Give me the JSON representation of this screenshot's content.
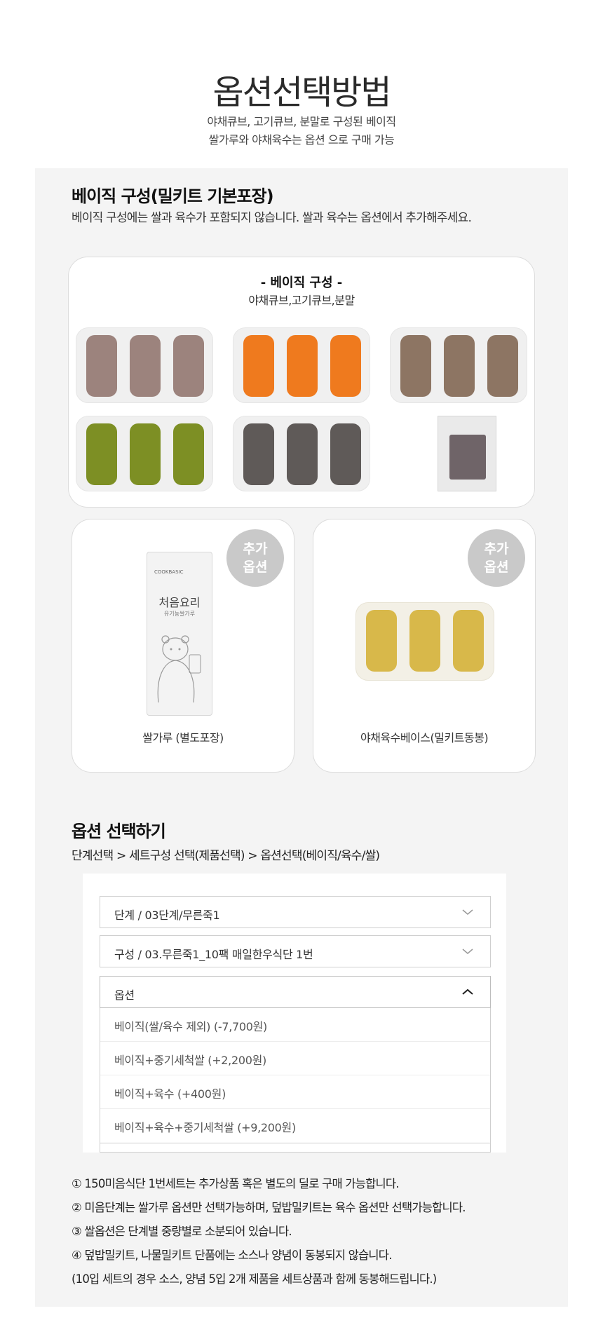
{
  "header": {
    "title": "옵션선택방법",
    "subtitle_line1": "야채큐브, 고기큐브, 분말로 구성된 베이직",
    "subtitle_line2": "쌀가루와 야채육수는 옵션 으로 구매 가능"
  },
  "basic_section": {
    "title": "베이직 구성(밀키트 기본포장)",
    "description": "베이직 구성에는 쌀과 육수가 포함되지 않습니다. 쌀과 육수는 옵션에서 추가해주세요.",
    "card_heading": "- 베이직 구성 -",
    "card_subheading": "야채큐브,고기큐브,분말",
    "cube_colors": [
      "#9c837d",
      "#ef7a1e",
      "#8d7563",
      "#7d8f24",
      "#5f5a58"
    ]
  },
  "option_cards": [
    {
      "badge_line1": "추가",
      "badge_line2": "옵션",
      "pouch_brand": "COOKBASIC",
      "pouch_name": "처음요리",
      "pouch_small": "유기농쌀가루",
      "caption": "쌀가루 (별도포장)"
    },
    {
      "badge_line1": "추가",
      "badge_line2": "옵션",
      "caption": "야채육수베이스(밀키트동봉)",
      "cube_color": "#d8b84a"
    }
  ],
  "option_select": {
    "title": "옵션 선택하기",
    "steps": "단계선택 > 세트구성 선택(제품선택) > 옵션선택(베이직/육수/쌀)",
    "step_select": "단계 / 03단계/무른죽1",
    "set_select": "구성 / 03.무른죽1_10팩 매일한우식단 1번",
    "option_select": "옵션",
    "dropdown_items": [
      "베이직(쌀/육수 제외) (-7,700원)",
      "베이직+중기세척쌀 (+2,200원)",
      "베이직+육수 (+400원)",
      "베이직+육수+중기세척쌀 (+9,200원)"
    ]
  },
  "notes": [
    "① 150미음식단 1번세트는 추가상품 혹은 별도의 딜로 구매 가능합니다.",
    "② 미음단계는 쌀가루 옵션만 선택가능하며, 덮밥밀키트는 육수 옵션만 선택가능합니다.",
    "③ 쌀옵션은 단계별 중량별로 소분되어 있습니다.",
    "④ 덮밥밀키트, 나물밀키트 단품에는 소스나 양념이 동봉되지 않습니다.",
    "(10입 세트의 경우 소스, 양념 5입 2개 제품을 세트상품과 함께 동봉해드립니다.)"
  ]
}
